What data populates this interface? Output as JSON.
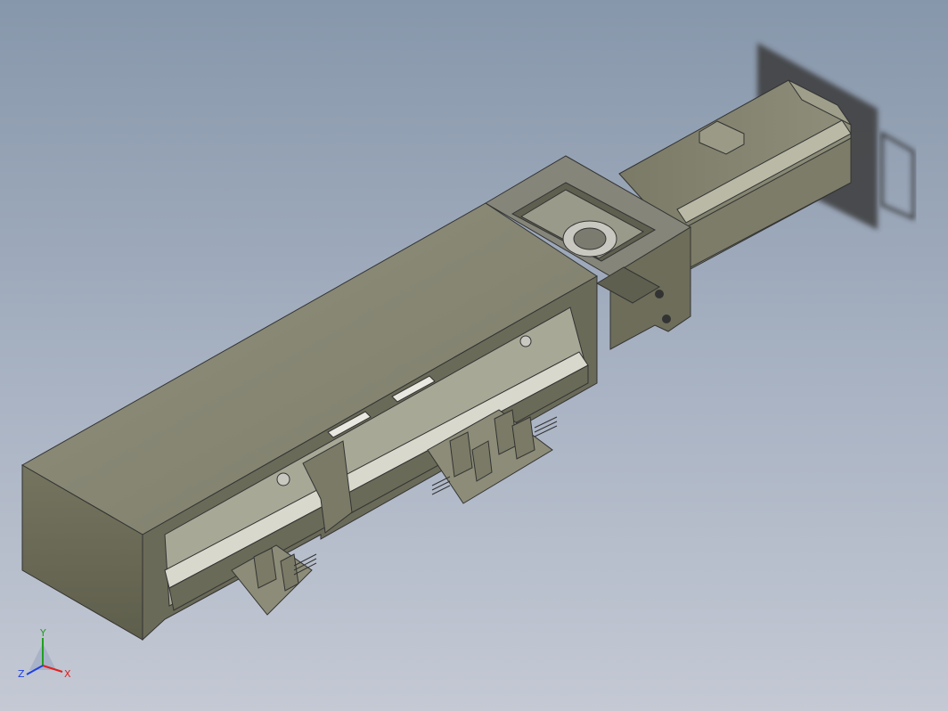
{
  "viewport": {
    "background_top": "#8797ab",
    "background_bottom": "#c4c9d4",
    "model_color": "#8a8a76",
    "model_description_icon": "linear-actuator-model"
  },
  "triad": {
    "x_label": "X",
    "y_label": "Y",
    "z_label": "Z",
    "x_color": "#e02020",
    "y_color": "#20a020",
    "z_color": "#2040e0"
  }
}
